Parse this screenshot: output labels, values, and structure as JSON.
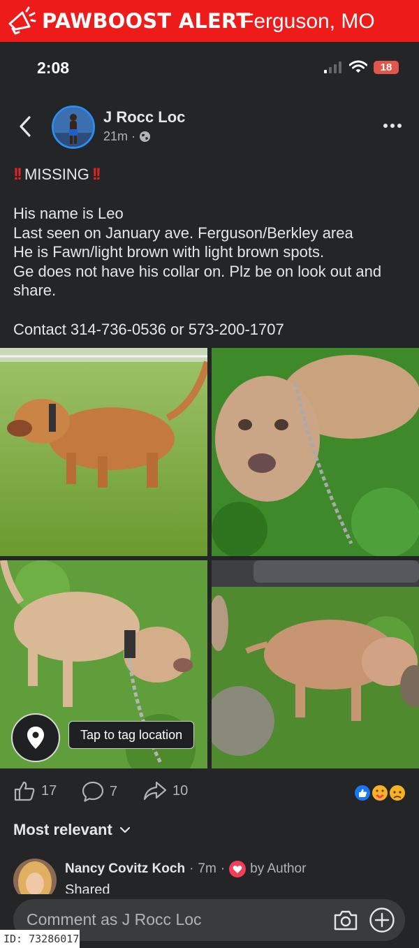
{
  "alert": {
    "title": "PAWBOOST ALERT",
    "location": "Ferguson, MO",
    "icon": "megaphone-icon",
    "color": "#ee1b1b"
  },
  "status_bar": {
    "time": "2:08",
    "battery": "18"
  },
  "post": {
    "author": "J Rocc Loc",
    "time": "21m",
    "separator": "·",
    "heading": "MISSING",
    "lines": [
      "His name is Leo",
      "Last seen on January ave. Ferguson/Berkley area",
      "He is Fawn/light brown with light brown spots.",
      "Ge does not have his collar on. Plz be on look out and share."
    ],
    "contact": "Contact 314-736-0536 or 573-200-1707",
    "tag_location_label": "Tap to tag location"
  },
  "actions": {
    "likes": "17",
    "comments": "7",
    "shares": "10"
  },
  "sort": {
    "label": "Most relevant"
  },
  "comment": {
    "name": "Nancy Covitz Koch",
    "separator": "·",
    "time": "7m",
    "separator2": "·",
    "author_badge": "by Author",
    "text": "Shared"
  },
  "composer": {
    "placeholder": "Comment as J Rocc Loc"
  },
  "footer": {
    "id": "ID: 73286017"
  },
  "colors": {
    "background": "#242526",
    "accent_blue": "#2d8cf0",
    "missing_red": "#e02424",
    "heart": "#f33e58"
  }
}
